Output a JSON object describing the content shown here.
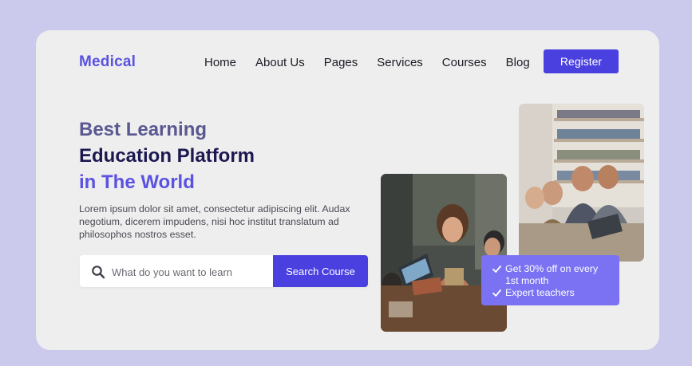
{
  "brand": {
    "name": "Medical"
  },
  "nav": {
    "items": [
      "Home",
      "About Us",
      "Pages",
      "Services",
      "Courses",
      "Blog"
    ]
  },
  "header": {
    "register_label": "Register"
  },
  "hero": {
    "title_line1": "Best Learning",
    "title_line2": "Education Platform",
    "title_line3": "in The World",
    "description": "Lorem ipsum dolor sit amet, consectetur adipiscing elit. Audax negotium, dicerem impudens, nisi hoc institut translatum ad philosophos nostros esset."
  },
  "search": {
    "placeholder": "What do you want to learn",
    "button_label": "Search Course"
  },
  "promo": {
    "items": [
      "Get 30% off on every 1st month",
      "Expert teachers"
    ]
  },
  "colors": {
    "accent": "#4a40e0",
    "brand": "#5b52e0",
    "promo_bg": "#7a72f2",
    "page_bg": "#cccaec",
    "card_bg": "#eeeeee"
  },
  "icons": {
    "search": "search-icon",
    "check": "check-icon"
  }
}
